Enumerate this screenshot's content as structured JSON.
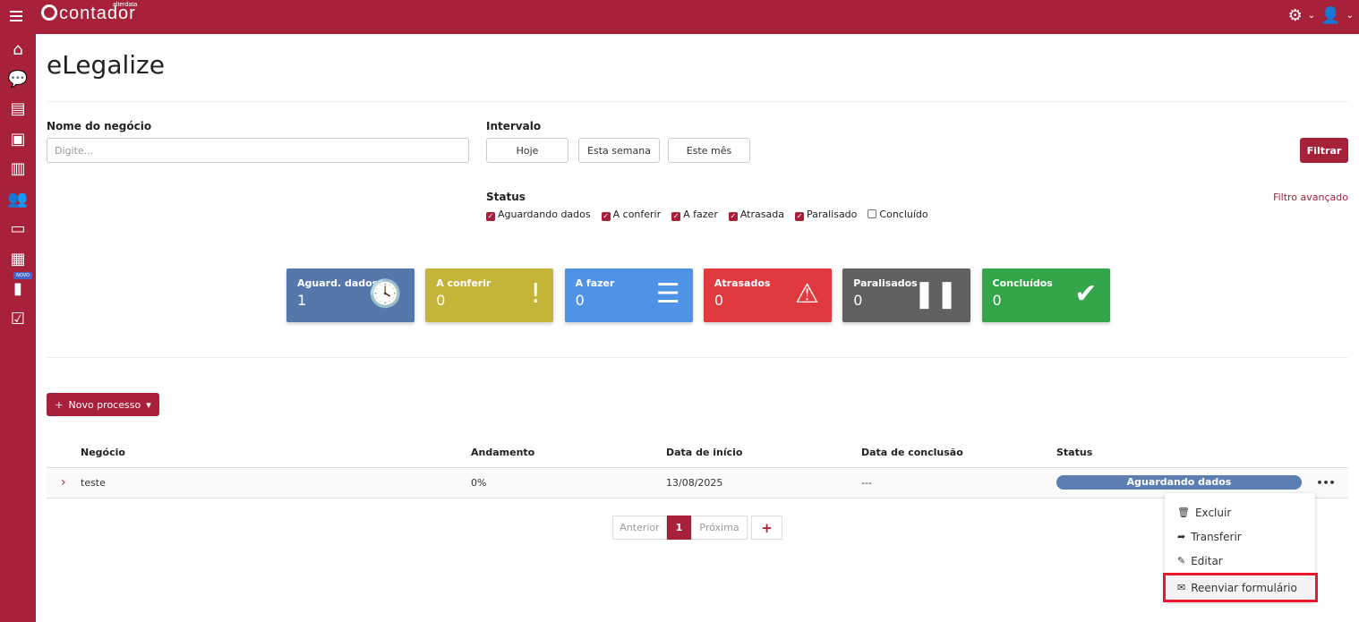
{
  "header": {
    "logo": "contador",
    "logo_brand": "alterdata"
  },
  "sidebar": {
    "items": [
      {
        "icon": "home-icon",
        "g": "⌂"
      },
      {
        "icon": "chat-icon",
        "g": "💬"
      },
      {
        "icon": "document-icon",
        "g": "▤"
      },
      {
        "icon": "contact-card-icon",
        "g": "▣"
      },
      {
        "icon": "building-icon",
        "g": "▥"
      },
      {
        "icon": "users-icon",
        "g": "👥"
      },
      {
        "icon": "credit-card-icon",
        "g": "▭"
      },
      {
        "icon": "calculator-icon",
        "g": "▦"
      },
      {
        "icon": "chart-icon",
        "g": "▮"
      },
      {
        "icon": "checkbox-icon",
        "g": "☑"
      }
    ],
    "novo_badge": "NOVO"
  },
  "page": {
    "title": "eLegalize"
  },
  "filters": {
    "name_label": "Nome do negócio",
    "name_placeholder": "Digite...",
    "interval_label": "Intervalo",
    "interval_buttons": [
      "Hoje",
      "Esta semana",
      "Este mês"
    ],
    "filter_button": "Filtrar",
    "advanced": "Filtro avançado",
    "status_label": "Status",
    "statuses": [
      {
        "label": "Aguardando dados",
        "checked": true
      },
      {
        "label": "A conferir",
        "checked": true
      },
      {
        "label": "A fazer",
        "checked": true
      },
      {
        "label": "Atrasada",
        "checked": true
      },
      {
        "label": "Paralisado",
        "checked": true
      },
      {
        "label": "Concluído",
        "checked": false
      }
    ]
  },
  "cards": [
    {
      "title": "Aguard. dados",
      "value": "1",
      "color": "#5677a9",
      "icon": "clock-icon",
      "g": "🕓"
    },
    {
      "title": "A conferir",
      "value": "0",
      "color": "#c5b43a",
      "icon": "exclamation-icon",
      "g": "!"
    },
    {
      "title": "A fazer",
      "value": "0",
      "color": "#4f93e6",
      "icon": "list-icon",
      "g": "☰"
    },
    {
      "title": "Atrasados",
      "value": "0",
      "color": "#e0393e",
      "icon": "warning-icon",
      "g": "⚠"
    },
    {
      "title": "Paralisados",
      "value": "0",
      "color": "#616161",
      "icon": "pause-icon",
      "g": "❚❚"
    },
    {
      "title": "Concluídos",
      "value": "0",
      "color": "#34a549",
      "icon": "check-icon",
      "g": "✔"
    }
  ],
  "new_process": "Novo processo",
  "table": {
    "headers": [
      "Negócio",
      "Andamento",
      "Data de início",
      "Data de conclusão",
      "Status"
    ],
    "rows": [
      {
        "negocio": "teste",
        "andamento": "0%",
        "inicio": "13/08/2025",
        "conclusao": "---",
        "status": "Aguardando dados"
      }
    ]
  },
  "pager": {
    "prev": "Anterior",
    "page": "1",
    "next": "Próxima",
    "add": "+"
  },
  "menu": {
    "items": [
      {
        "label": "Excluir",
        "icon": "trash-icon",
        "g": "🗑"
      },
      {
        "label": "Transferir",
        "icon": "share-icon",
        "g": "➦"
      },
      {
        "label": "Editar",
        "icon": "pencil-icon",
        "g": "✎"
      },
      {
        "label": "Reenviar formulário",
        "icon": "envelope-icon",
        "g": "✉"
      }
    ]
  }
}
